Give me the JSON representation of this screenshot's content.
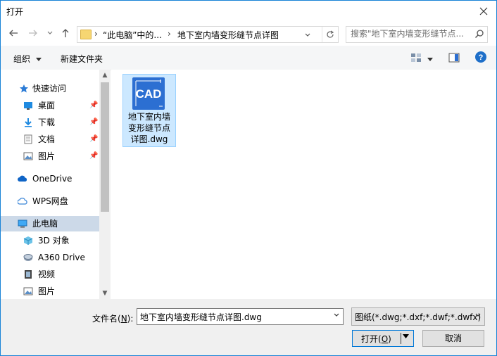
{
  "window": {
    "title": "打开",
    "close_icon": "close-icon"
  },
  "address": {
    "crumb1": "“此电脑”中的...",
    "crumb2": "地下室内墙变形缝节点详图",
    "search_placeholder": "搜索\"地下室内墙变形缝节点...",
    "sep": "›"
  },
  "toolbar": {
    "organize": "组织",
    "new_folder": "新建文件夹"
  },
  "nav": {
    "quick_access": "快速访问",
    "desktop": "桌面",
    "downloads": "下载",
    "documents": "文档",
    "pictures": "图片",
    "onedrive": "OneDrive",
    "wps": "WPS网盘",
    "this_pc": "此电脑",
    "objects3d": "3D 对象",
    "a360": "A360 Drive",
    "videos": "视频",
    "pictures2": "图片"
  },
  "file": {
    "icon_label": "CAD",
    "name": "地下室内墙变形缝节点详图.dwg"
  },
  "bottom": {
    "filename_label_pre": "文件名(",
    "filename_label_key": "N",
    "filename_label_post": "):",
    "filename_value": "地下室内墙变形缝节点详图.dwg",
    "filter_value": "图纸(*.dwg;*.dxf;*.dwf;*.dwfx)",
    "open_pre": "打开(",
    "open_key": "O",
    "open_post": ")",
    "cancel": "取消"
  },
  "colors": {
    "accent": "#0078d7",
    "selection": "#cce8ff",
    "cad_blue": "#2c6fd2"
  }
}
